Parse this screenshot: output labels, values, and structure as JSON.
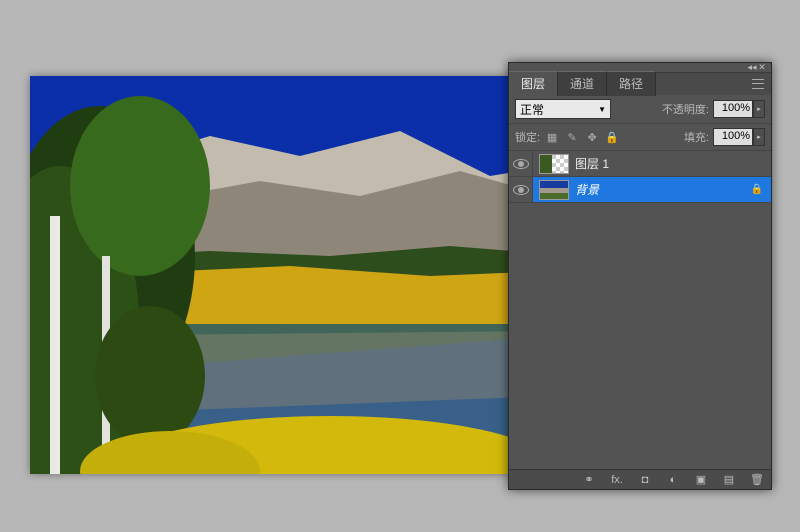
{
  "tabs": {
    "layers": "图层",
    "channels": "通道",
    "paths": "路径"
  },
  "blend_mode": "正常",
  "opacity": {
    "label": "不透明度:",
    "value": "100%"
  },
  "fill": {
    "label": "填充:",
    "value": "100%"
  },
  "lock_label": "锁定:",
  "layers": [
    {
      "name": "图层 1",
      "locked": false
    },
    {
      "name": "背景",
      "locked": true
    }
  ],
  "footer": {
    "link": "⚭",
    "fx": "fx.",
    "mask": "◘",
    "adjust": "◐",
    "group": "▣",
    "new": "▤",
    "trash": "🗑"
  }
}
